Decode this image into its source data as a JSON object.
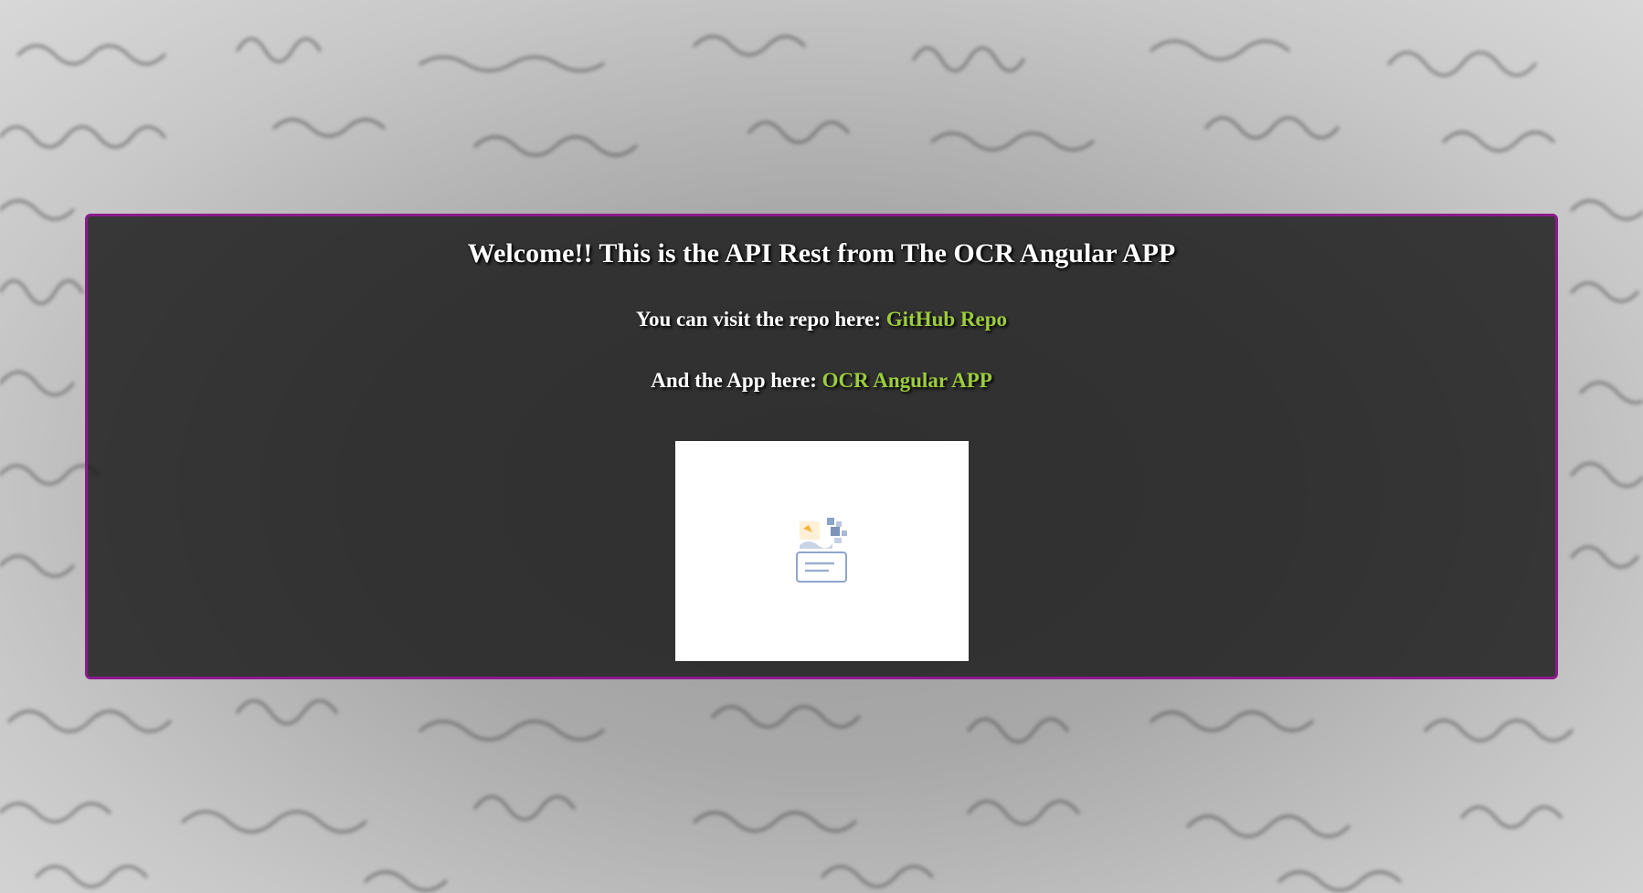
{
  "header": {
    "title": "Welcome!! This is the API Rest from The OCR Angular APP"
  },
  "repo": {
    "prefix": "You can visit the repo here:",
    "link_text": "GitHub Repo"
  },
  "app": {
    "prefix": "And the App here:",
    "link_text": "OCR Angular APP"
  },
  "image": {
    "icon": "broken-image-icon"
  },
  "colors": {
    "link": "#9ccc3d",
    "panel_border": "#8b1a8b",
    "panel_background": "#1c1c1c"
  }
}
